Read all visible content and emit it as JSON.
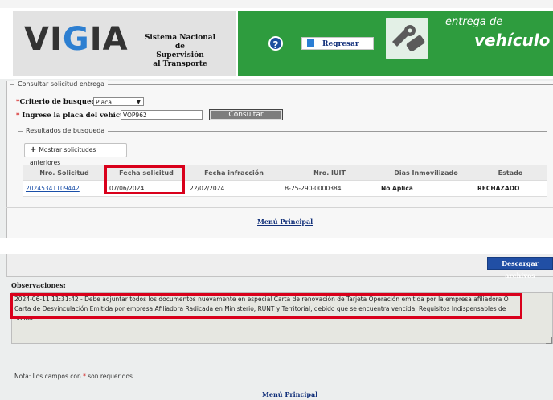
{
  "header": {
    "logo_text": "VIGIA",
    "system_name_lines": [
      "Sistema Nacional de",
      "Supervisión",
      "al Transporte"
    ],
    "back_button_label": "Regresar",
    "banner_line1": "entrega de",
    "banner_line2": "vehículo",
    "icons": [
      "help-icon",
      "back-icon",
      "keys-icon"
    ]
  },
  "search": {
    "legend": "Consultar solicitud entrega",
    "criterion_label": "Criterio de busqueda:",
    "criterion_value": "Placa",
    "plate_label": "Ingrese la placa del vehículo:",
    "plate_value": "VOP962",
    "consult_button": "Consultar",
    "required_mark": "*"
  },
  "results": {
    "legend": "Resultados de busqueda",
    "show_previous_button": "Mostrar solicitudes anteriores",
    "columns": [
      "Nro. Solicitud",
      "Fecha solicitud",
      "Fecha infracción",
      "Nro. IUIT",
      "Dias Inmovilizado",
      "Estado"
    ],
    "rows": [
      {
        "nro_solicitud": "20245341109442",
        "fecha_solicitud": "07/06/2024",
        "fecha_infraccion": "22/02/2024",
        "nro_iuit": "B-25-290-0000384",
        "dias_inmovilizado": "No Aplica",
        "estado": "RECHAZADO"
      }
    ]
  },
  "menu_principal": "Menú Principal",
  "download_button": "Descargar archivos",
  "observations": {
    "label": "Observaciones:",
    "text": "2024-06-11 11:31:42 - Debe adjuntar todos los documentos nuevamente en especial Carta de renovación de Tarjeta Operación emitida por la empresa afiliadora O Carta de Desvinculación Emitida por empresa Afiliadora Radicada en Ministerio, RUNT y Territorial, debido que se encuentra vencida, Requisitos Indispensables de Salida"
  },
  "note": {
    "prefix": "Nota: Los campos con",
    "mark": "*",
    "suffix": "son requeridos."
  },
  "colors": {
    "banner_green": "#2e9c3e",
    "highlight_red": "#d9001b",
    "link_blue": "#1a4fa8",
    "download_blue": "#214fa5"
  }
}
